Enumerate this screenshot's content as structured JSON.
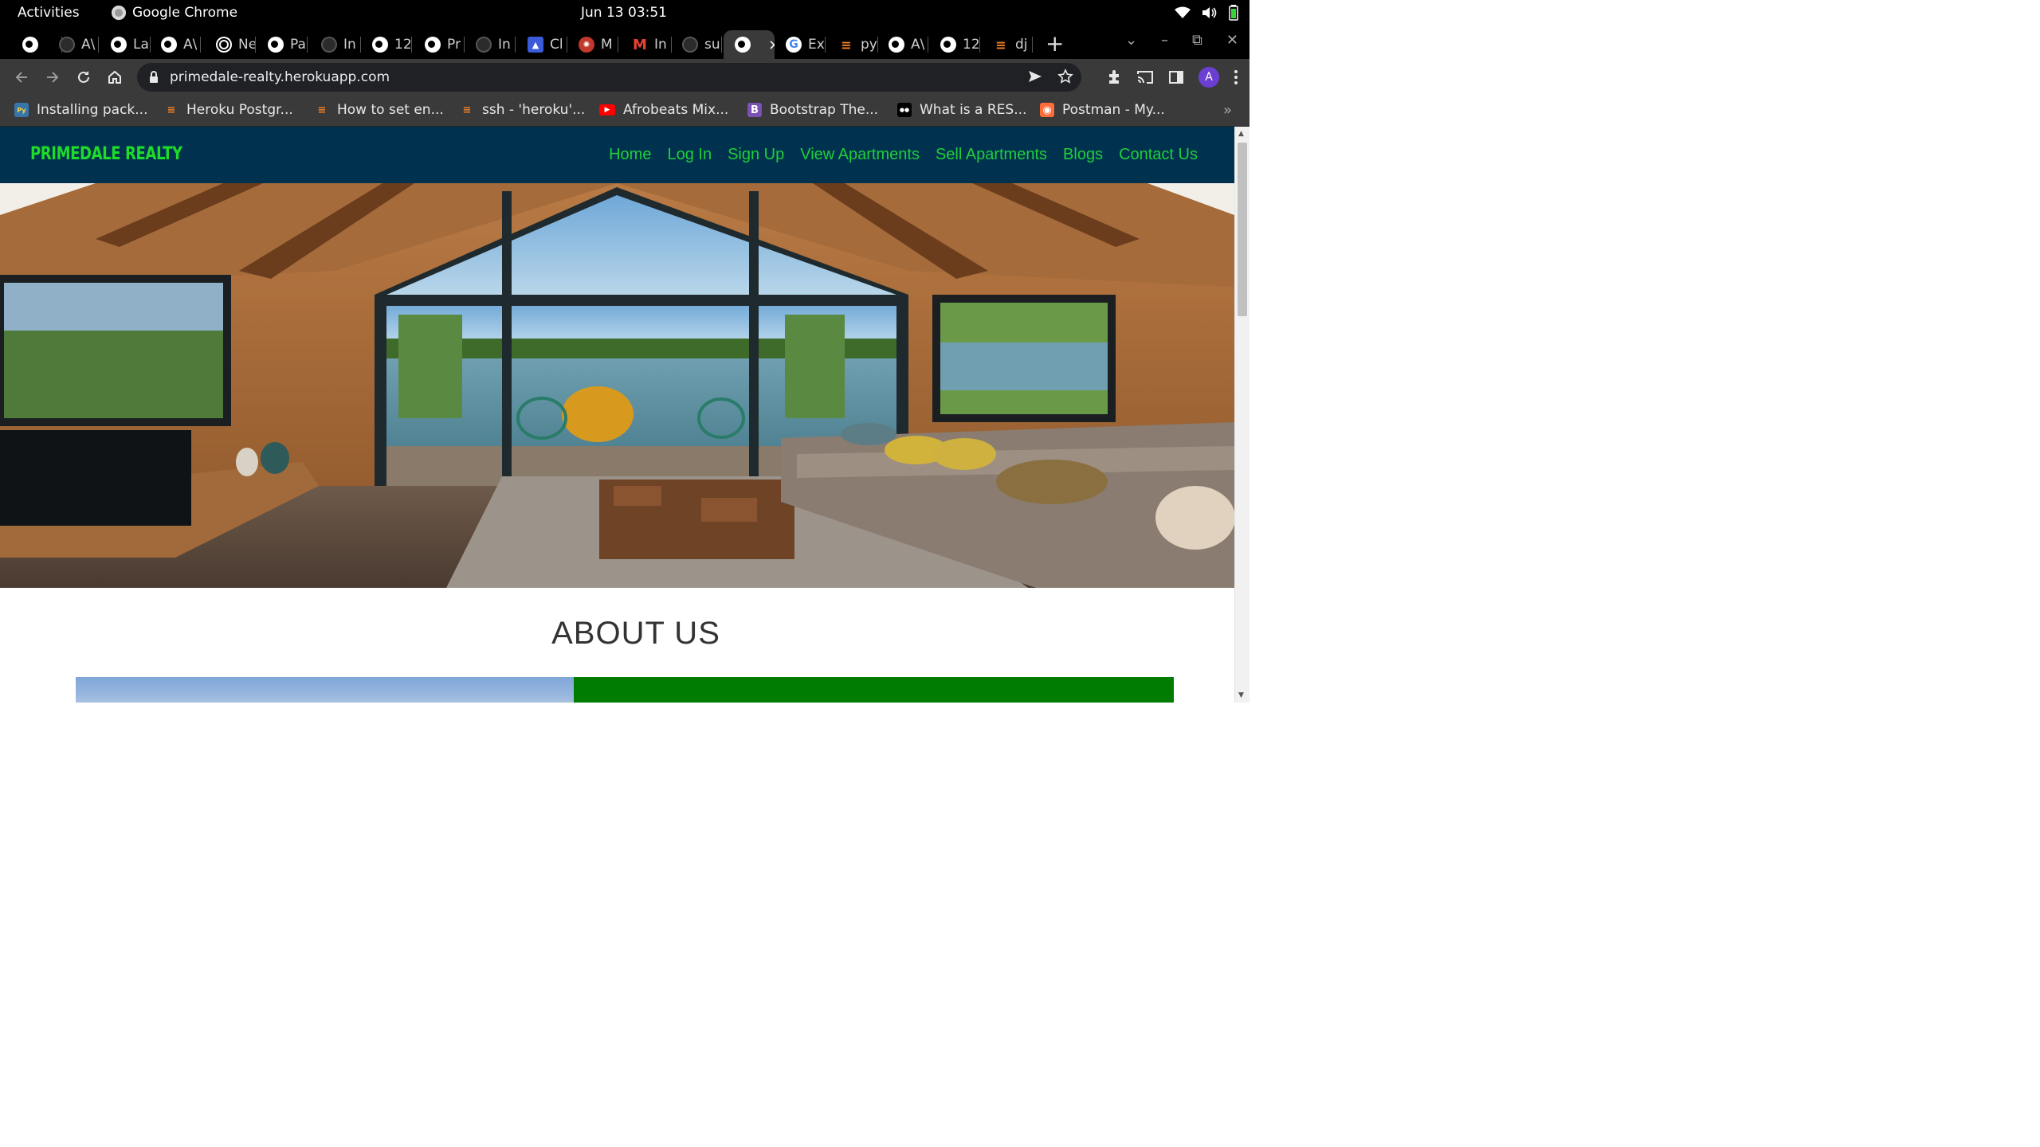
{
  "system_bar": {
    "activities": "Activities",
    "app_name": "Google Chrome",
    "clock": "Jun 13  03:51"
  },
  "tabs": [
    {
      "icon": "globe-icon",
      "label": ""
    },
    {
      "icon": "github-icon",
      "label": "A\\"
    },
    {
      "icon": "globe-icon",
      "label": "La"
    },
    {
      "icon": "globe-icon",
      "label": "A\\"
    },
    {
      "icon": "chrome-icon",
      "label": "Ne"
    },
    {
      "icon": "globe-icon",
      "label": "Pa"
    },
    {
      "icon": "github-icon",
      "label": "In"
    },
    {
      "icon": "globe-icon",
      "label": "12"
    },
    {
      "icon": "globe-icon",
      "label": "Pr"
    },
    {
      "icon": "github-icon",
      "label": "In"
    },
    {
      "icon": "heroku-icon",
      "label": "Cl"
    },
    {
      "icon": "app-icon",
      "label": "M"
    },
    {
      "icon": "gmail-icon",
      "label": "In"
    },
    {
      "icon": "github-icon",
      "label": "su"
    },
    {
      "icon": "globe-icon",
      "label": "",
      "active": true
    },
    {
      "icon": "google-icon",
      "label": "Ex"
    },
    {
      "icon": "stackoverflow-icon",
      "label": "py"
    },
    {
      "icon": "globe-icon",
      "label": "A\\"
    },
    {
      "icon": "globe-icon",
      "label": "12"
    },
    {
      "icon": "stackoverflow-icon",
      "label": "dj"
    }
  ],
  "tab_close": "×",
  "new_tab": "+",
  "address_bar": {
    "url": "primedale-realty.herokuapp.com"
  },
  "profile_initial": "A",
  "bookmarks": [
    {
      "icon": "python-icon",
      "label": "Installing pack..."
    },
    {
      "icon": "stackoverflow-icon",
      "label": "Heroku Postgr..."
    },
    {
      "icon": "stackoverflow-icon",
      "label": "How to set en..."
    },
    {
      "icon": "stackoverflow-icon",
      "label": "ssh - 'heroku'..."
    },
    {
      "icon": "youtube-icon",
      "label": "Afrobeats Mix..."
    },
    {
      "icon": "bootstrap-icon",
      "label": "Bootstrap The..."
    },
    {
      "icon": "medium-icon",
      "label": "What is a RES..."
    },
    {
      "icon": "postman-icon",
      "label": "Postman - My..."
    }
  ],
  "site": {
    "brand": "PRIMEDALE REALTY",
    "nav": [
      "Home",
      "Log In",
      "Sign Up",
      "View Apartments",
      "Sell Apartments",
      "Blogs",
      "Contact Us"
    ],
    "about_title": "ABOUT US"
  },
  "colors": {
    "navbar_bg": "#003250",
    "brand_green": "#1ddc2a",
    "link_green": "#1fcf3a",
    "about_green_panel": "#007d00"
  }
}
